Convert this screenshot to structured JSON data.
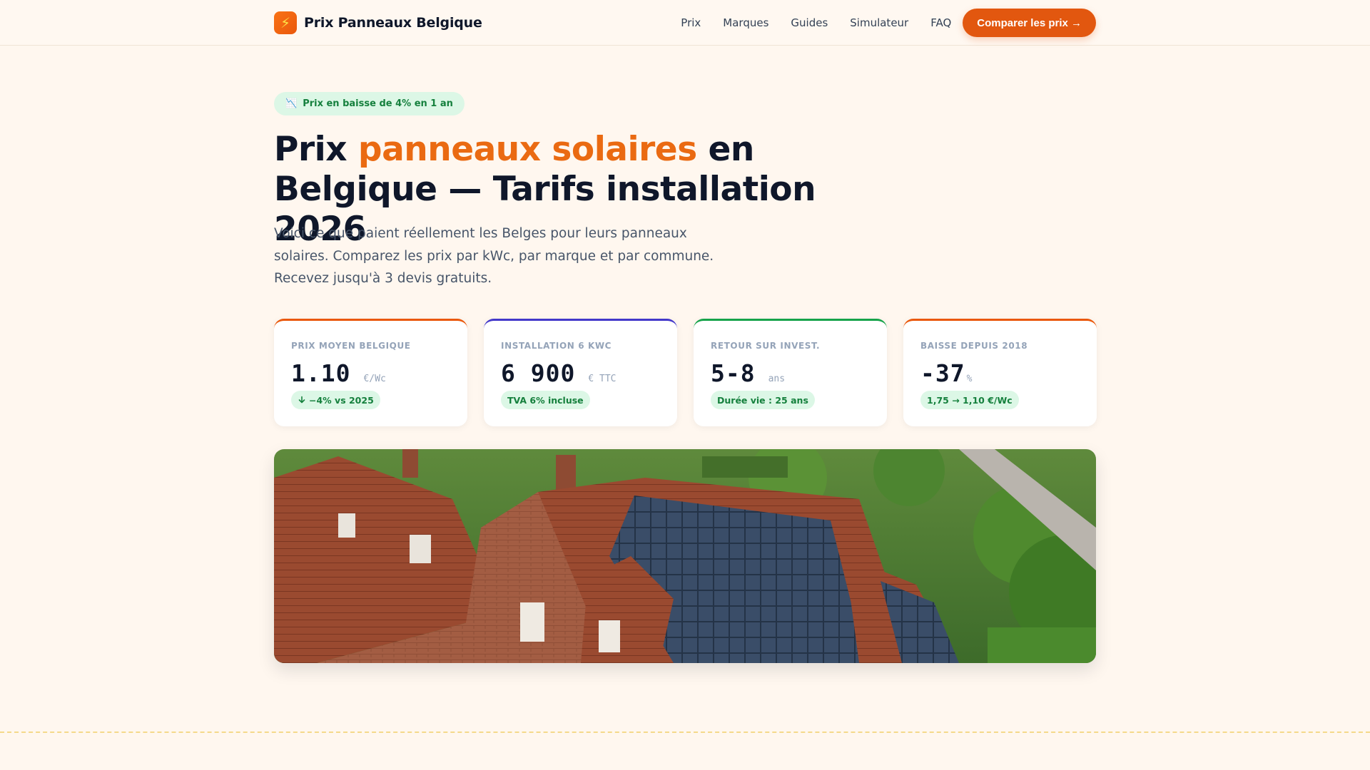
{
  "header": {
    "brand_icon": "lightning-bolt-icon",
    "brand_icon_glyph": "⚡",
    "brand_name": "Prix Panneaux Belgique",
    "nav": [
      "Prix",
      "Marques",
      "Guides",
      "Simulateur",
      "FAQ"
    ],
    "cta_label": "Comparer les prix →"
  },
  "hero": {
    "badge_icon": "chart-decreasing-icon",
    "badge_icon_glyph": "📉",
    "badge_text": "Prix en baisse de 4% en 1 an",
    "title_part1": "Prix ",
    "title_accent": "panneaux solaires",
    "title_part2": " en Belgique — Tarifs installation 2026",
    "lead": "Voici ce que paient réellement les Belges pour leurs panneaux solaires. Comparez les prix par kWc, par marque et par commune. Recevez jusqu'à 3 devis gratuits."
  },
  "stats": [
    {
      "label": "Prix moyen Belgique",
      "value": "1.10",
      "unit": "€/Wc",
      "pill": "−4% vs 2025",
      "pill_icon": "arrow-down-icon",
      "accent": "#ea580c"
    },
    {
      "label": "Installation 6 kWc",
      "value": "6 900",
      "unit": "€ TTC",
      "pill": "TVA 6% incluse",
      "accent": "#4338ca"
    },
    {
      "label": "Retour sur invest.",
      "value": "5-8",
      "unit": "ans",
      "pill": "Durée vie : 25 ans",
      "accent": "#16a34a"
    },
    {
      "label": "Baisse depuis 2018",
      "value": "-37",
      "unit": "%",
      "pill": "1,75 → 1,10 €/Wc",
      "accent": "#ea580c"
    }
  ],
  "colors": {
    "accent": "#ea6a12",
    "cta": "#e2570f",
    "success_bg": "#dcf7e6",
    "success_text": "#15803d",
    "background": "#fff7ef"
  }
}
